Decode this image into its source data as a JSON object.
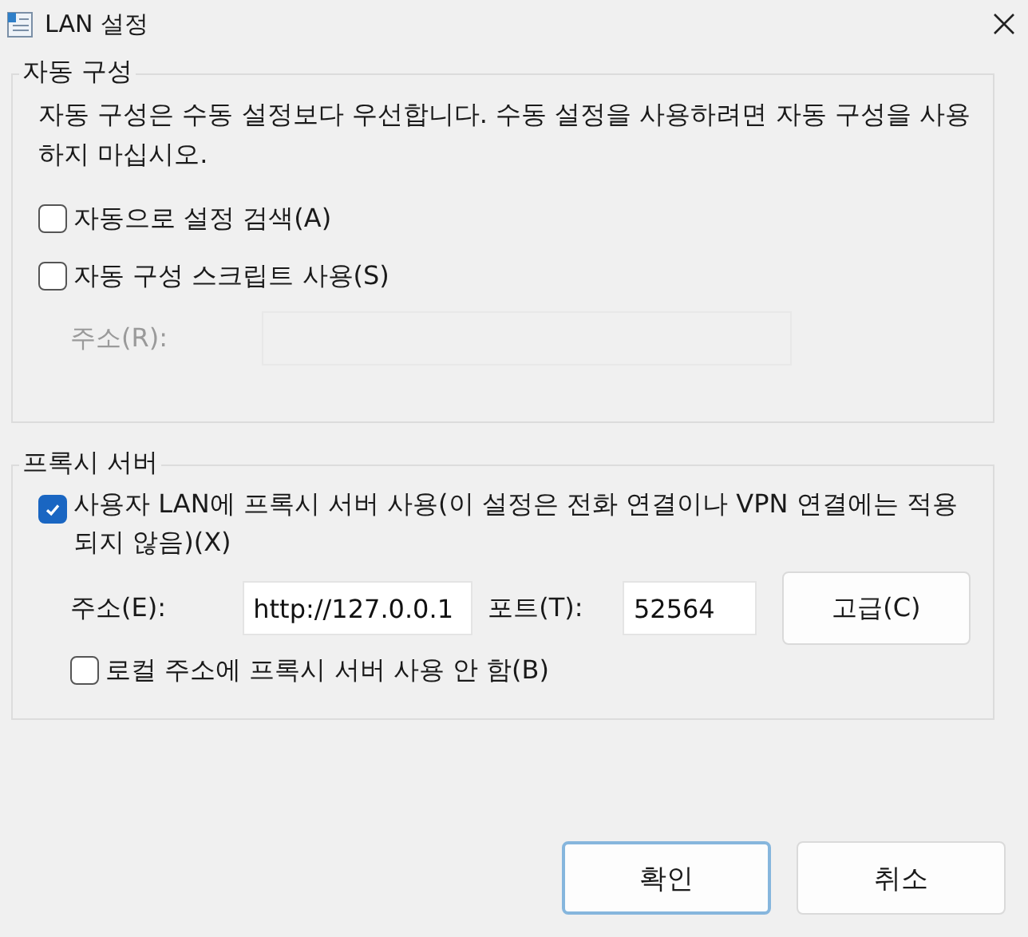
{
  "window": {
    "title": "LAN 설정"
  },
  "auto_config": {
    "title": "자동 구성",
    "description": "자동 구성은 수동 설정보다 우선합니다. 수동 설정을 사용하려면 자동 구성을 사용하지 마십시오.",
    "options": [
      {
        "label": "자동으로 설정 검색(A)",
        "checked": false
      },
      {
        "label": "자동 구성 스크립트 사용(S)",
        "checked": false
      }
    ],
    "address": {
      "label": "주소(R):",
      "disabled": true
    }
  },
  "proxy": {
    "title": "프록시 서버",
    "use_proxy": {
      "label": "사용자 LAN에 프록시 서버 사용(이 설정은 전화 연결이나 VPN 연결에는 적용되지 않음)(X)",
      "checked": true
    },
    "address": {
      "label": "주소(E):",
      "value": "http://127.0.0.1"
    },
    "port": {
      "label": "포트(T):",
      "value": "52564"
    },
    "advanced_button": "고급(C)",
    "bypass_local": {
      "label": "로컬 주소에 프록시 서버 사용 안 함(B)",
      "checked": false
    }
  },
  "buttons": [
    {
      "label": "확인",
      "default": true
    },
    {
      "label": "취소",
      "default": false
    }
  ]
}
